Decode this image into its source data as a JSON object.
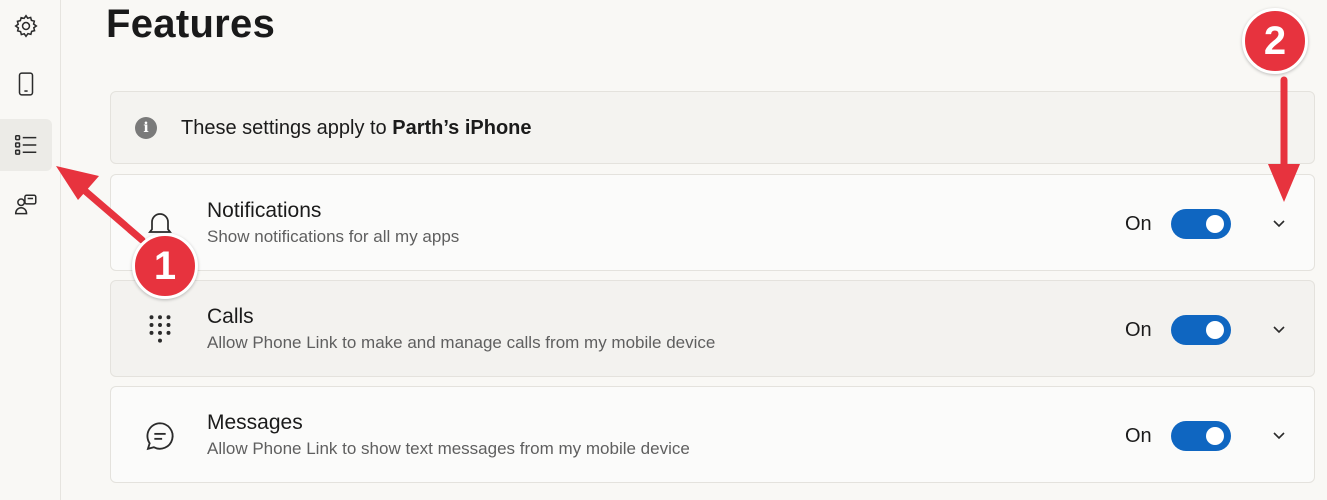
{
  "sidebar": {
    "items": [
      {
        "icon": "gear-icon",
        "active": false
      },
      {
        "icon": "phone-icon",
        "active": false
      },
      {
        "icon": "features-list-icon",
        "active": true
      },
      {
        "icon": "devices-icon",
        "active": false
      }
    ]
  },
  "page": {
    "title": "Features"
  },
  "info": {
    "icon": "info-icon",
    "icon_glyph": "i",
    "text_prefix": "These settings apply to ",
    "device_name": "Parth’s iPhone"
  },
  "features": [
    {
      "icon": "bell-icon",
      "title": "Notifications",
      "description": "Show notifications for all my apps",
      "state_label": "On",
      "enabled": true
    },
    {
      "icon": "dialpad-icon",
      "title": "Calls",
      "description": "Allow Phone Link to make and manage calls from my mobile device",
      "state_label": "On",
      "enabled": true
    },
    {
      "icon": "chat-bubble-icon",
      "title": "Messages",
      "description": "Allow Phone Link to show text messages from my mobile device",
      "state_label": "On",
      "enabled": true
    }
  ],
  "annotations": {
    "badges": [
      {
        "label": "1"
      },
      {
        "label": "2"
      }
    ],
    "color": "#e7333e"
  },
  "colors": {
    "accent": "#0f66c1",
    "background": "#f9f8f5"
  }
}
